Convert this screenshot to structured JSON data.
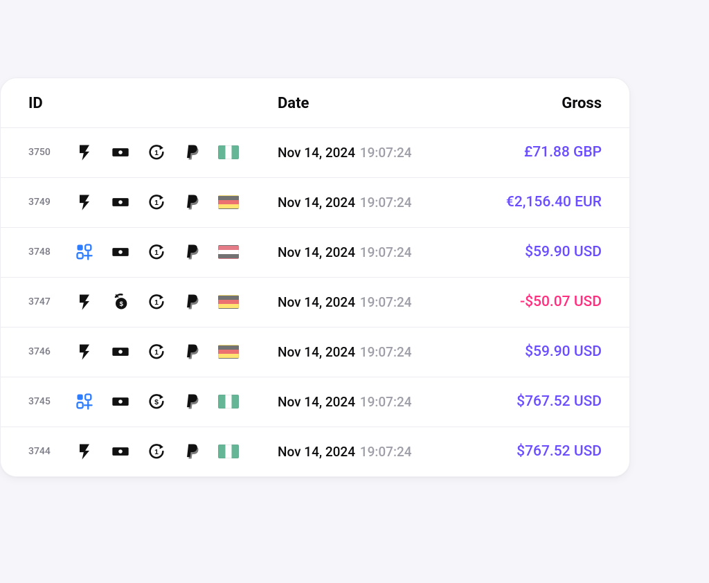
{
  "columns": {
    "id": "ID",
    "date": "Date",
    "gross": "Gross"
  },
  "colors": {
    "positive": "#6b4dff",
    "negative": "#ff2e7e"
  },
  "rows": [
    {
      "id": "3750",
      "type_icon": "funnel",
      "payment_icon": "cash",
      "recur_icon": "recur1",
      "method_icon": "paypal",
      "flag": "ng",
      "date": "Nov 14, 2024",
      "time": "19:07:24",
      "gross": "£71.88 GBP",
      "sign": "pos"
    },
    {
      "id": "3749",
      "type_icon": "funnel",
      "payment_icon": "cash",
      "recur_icon": "recur1",
      "method_icon": "paypal",
      "flag": "de",
      "date": "Nov 14, 2024",
      "time": "19:07:24",
      "gross": "€2,156.40 EUR",
      "sign": "pos"
    },
    {
      "id": "3748",
      "type_icon": "addon",
      "payment_icon": "cash",
      "recur_icon": "recur1",
      "method_icon": "paypal",
      "flag": "eg",
      "date": "Nov 14, 2024",
      "time": "19:07:24",
      "gross": "$59.90 USD",
      "sign": "pos"
    },
    {
      "id": "3747",
      "type_icon": "funnel",
      "payment_icon": "refund",
      "recur_icon": "recur1",
      "method_icon": "paypal",
      "flag": "de",
      "date": "Nov 14, 2024",
      "time": "19:07:24",
      "gross": "-$50.07 USD",
      "sign": "neg"
    },
    {
      "id": "3746",
      "type_icon": "funnel",
      "payment_icon": "cash",
      "recur_icon": "recur1",
      "method_icon": "paypal",
      "flag": "de",
      "date": "Nov 14, 2024",
      "time": "19:07:24",
      "gross": "$59.90 USD",
      "sign": "pos"
    },
    {
      "id": "3745",
      "type_icon": "addon",
      "payment_icon": "cash",
      "recur_icon": "recurS",
      "method_icon": "paypal",
      "flag": "ng",
      "date": "Nov 14, 2024",
      "time": "19:07:24",
      "gross": "$767.52 USD",
      "sign": "pos"
    },
    {
      "id": "3744",
      "type_icon": "funnel",
      "payment_icon": "cash",
      "recur_icon": "recur1",
      "method_icon": "paypal",
      "flag": "ng",
      "date": "Nov 14, 2024",
      "time": "19:07:24",
      "gross": "$767.52 USD",
      "sign": "pos"
    }
  ]
}
